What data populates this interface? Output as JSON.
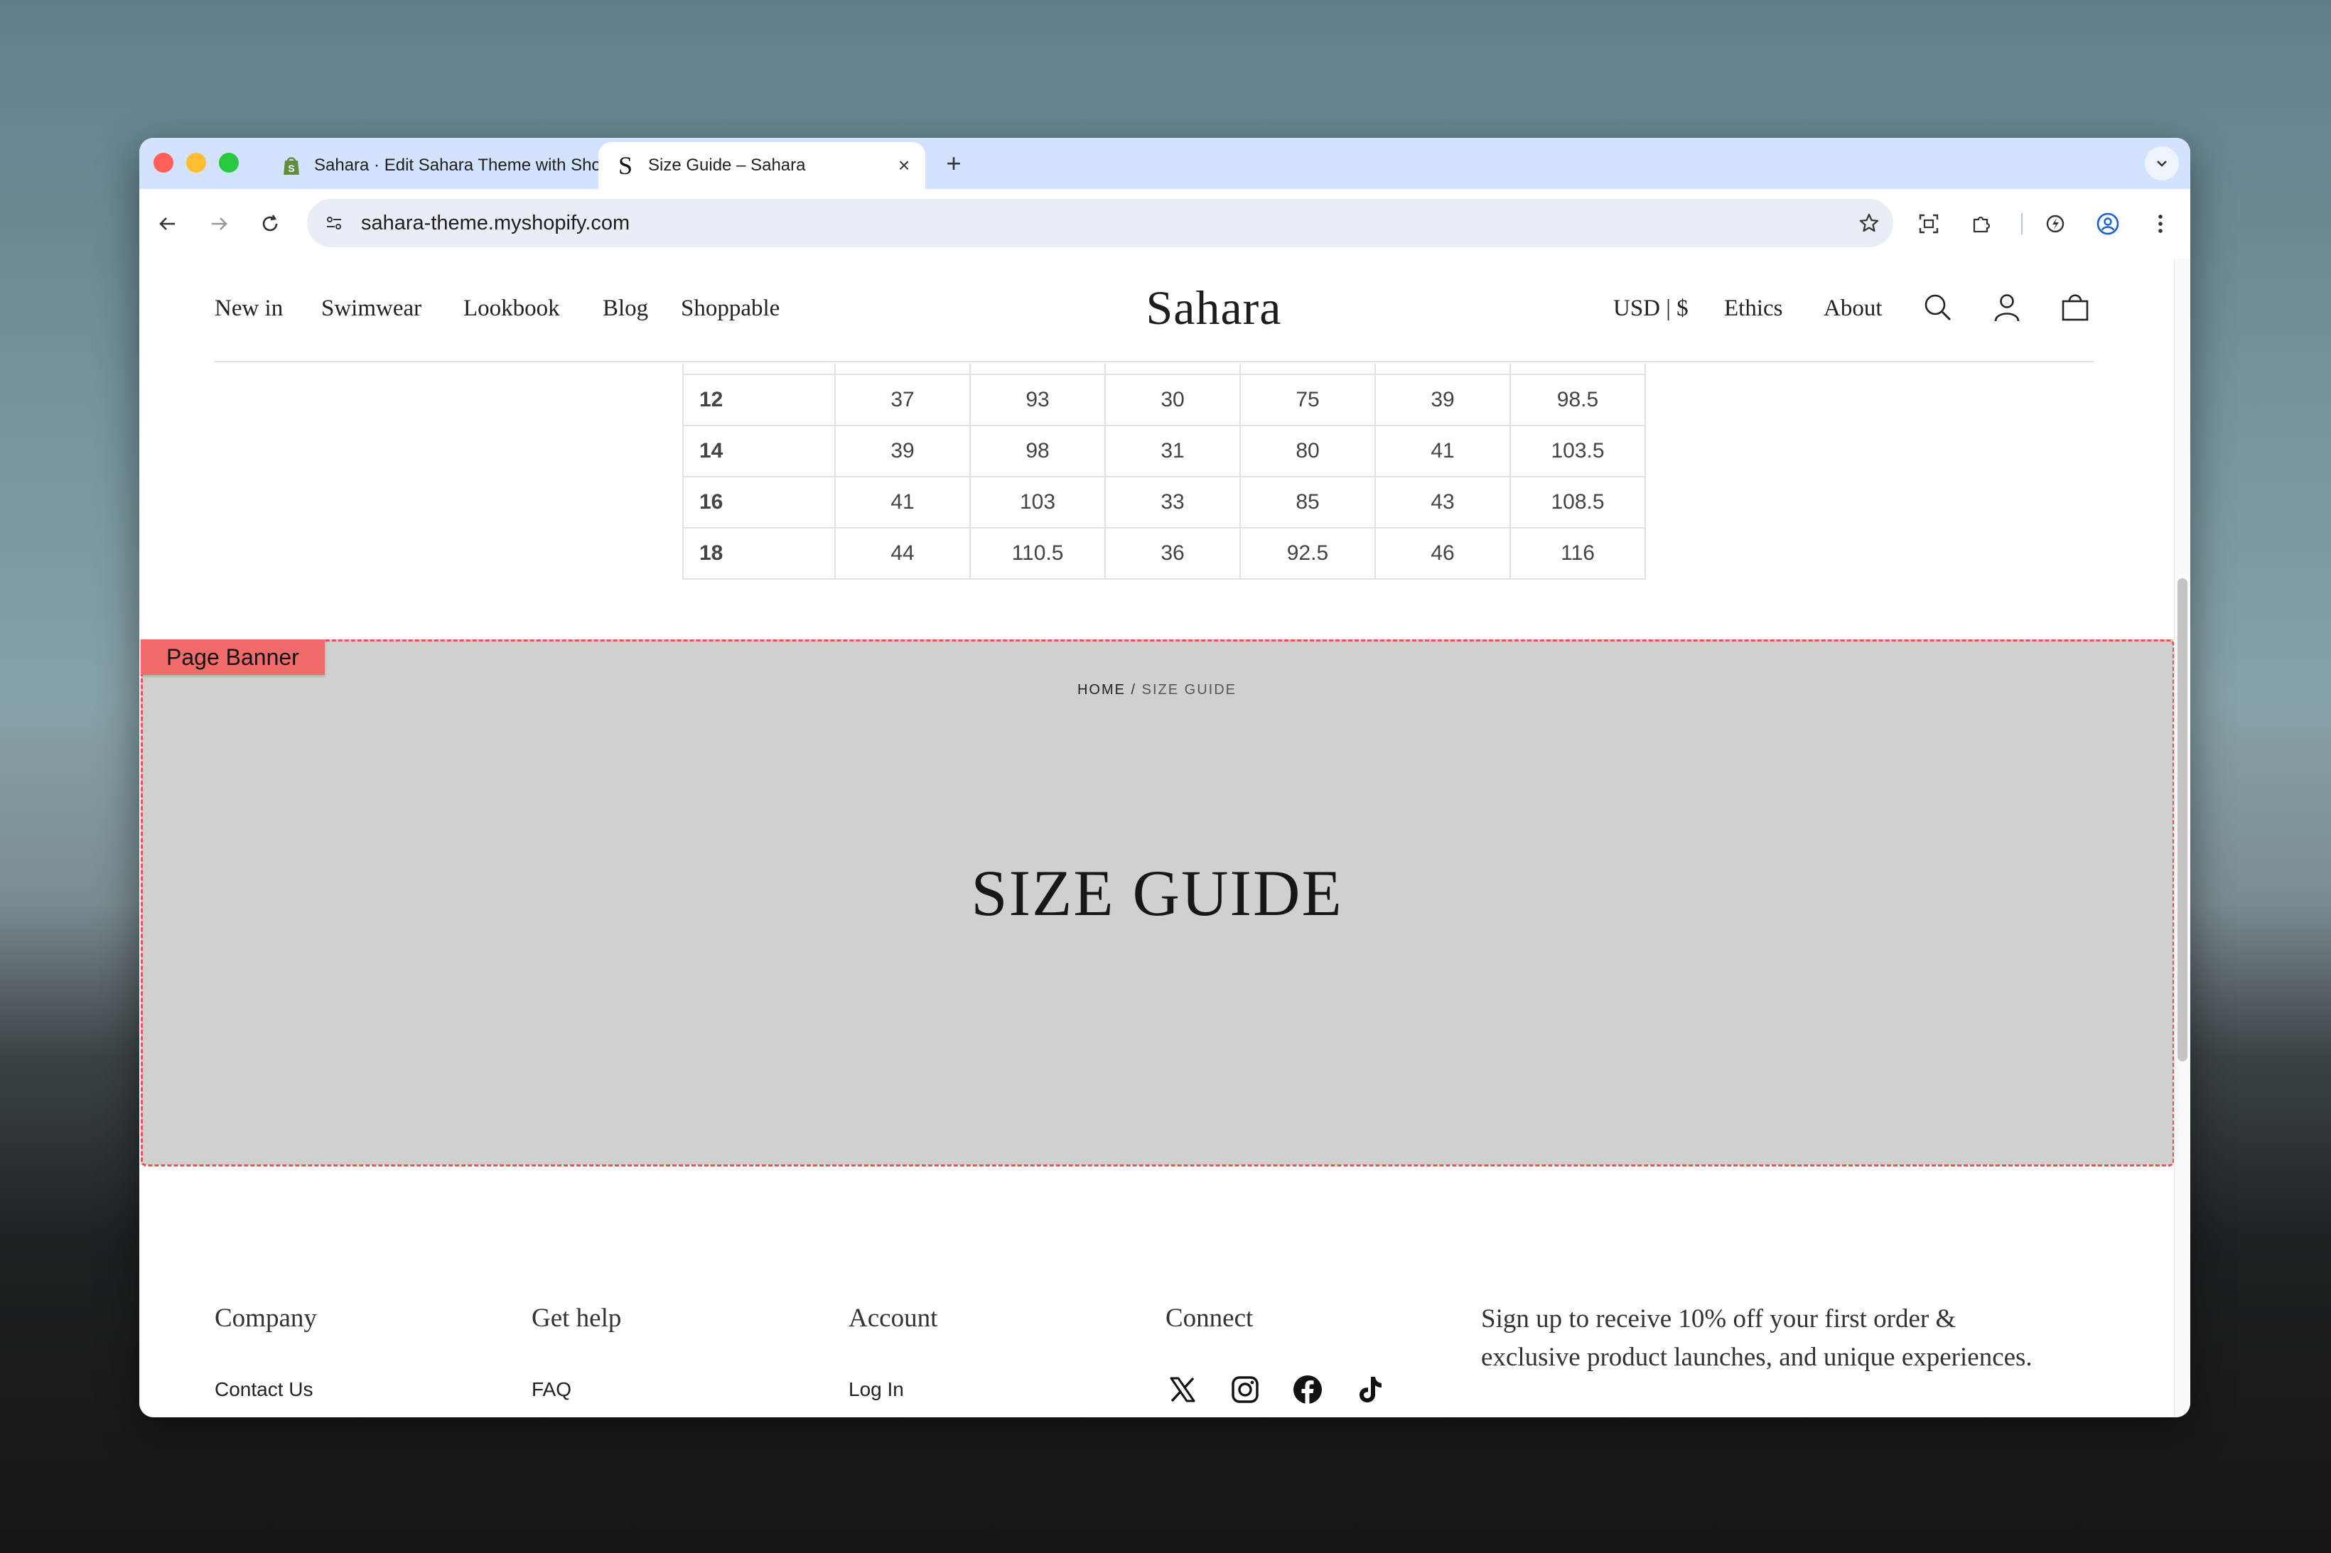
{
  "browser": {
    "tabs": [
      {
        "title": "Sahara · Edit Sahara Theme with Shopify",
        "favicon": "shopify-bag-icon"
      },
      {
        "title": "Size Guide – Sahara",
        "favicon": "sahara-s-icon"
      }
    ],
    "url": "sahara-theme.myshopify.com"
  },
  "site": {
    "logo": "Sahara",
    "nav_left": [
      "New in",
      "Swimwear",
      "Lookbook",
      "Blog",
      "Shoppable"
    ],
    "currency": "USD | $",
    "nav_right": [
      "Ethics",
      "About"
    ]
  },
  "size_table": {
    "rows": [
      {
        "size": "12",
        "values": [
          "37",
          "93",
          "30",
          "75",
          "39",
          "98.5"
        ]
      },
      {
        "size": "14",
        "values": [
          "39",
          "98",
          "31",
          "80",
          "41",
          "103.5"
        ]
      },
      {
        "size": "16",
        "values": [
          "41",
          "103",
          "33",
          "85",
          "43",
          "108.5"
        ]
      },
      {
        "size": "18",
        "values": [
          "44",
          "110.5",
          "36",
          "92.5",
          "46",
          "116"
        ]
      }
    ]
  },
  "banner": {
    "tag": "Page Banner",
    "breadcrumb_home": "HOME",
    "breadcrumb_sep": "/",
    "breadcrumb_current": "SIZE GUIDE",
    "title": "SIZE GUIDE"
  },
  "footer": {
    "company_heading": "Company",
    "company_link": "Contact Us",
    "help_heading": "Get help",
    "help_link": "FAQ",
    "account_heading": "Account",
    "account_link": "Log In",
    "connect_heading": "Connect",
    "newsletter": "Sign up to receive 10% off your first order & exclusive product launches, and unique experiences."
  },
  "colors": {
    "tabbar": "#d3e3fd",
    "banner_bg": "#d0d1ce",
    "banner_outline": "#ef4f55",
    "banner_tag": "#f26b6b"
  }
}
